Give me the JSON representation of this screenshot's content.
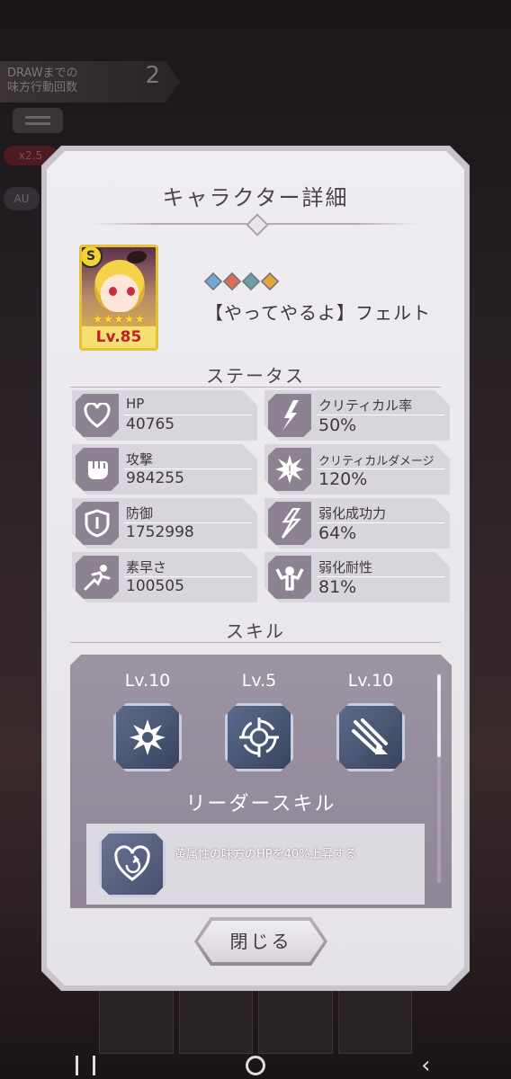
{
  "background": {
    "draw_label": "DRAWまでの\n味方行動回数",
    "draw_count": "2",
    "speed_label": "x2.5",
    "auto_label": "AU"
  },
  "dialog": {
    "title": "キャラクター詳細",
    "character": {
      "level_label": "Lv.85",
      "stars": "★★★★★",
      "attribute_symbol": "S",
      "name": "【やってやるよ】フェルト",
      "gem_colors": [
        "#6fa8d6",
        "#d9705e",
        "#6aa0a8",
        "#e3a43a"
      ]
    },
    "status_heading": "ステータス",
    "stats": [
      {
        "label": "HP",
        "value": "40765",
        "icon": "heart-icon"
      },
      {
        "label": "クリティカル率",
        "value": "50%",
        "icon": "critical-bolt-icon"
      },
      {
        "label": "攻撃",
        "value": "984255",
        "icon": "fist-icon"
      },
      {
        "label": "クリティカルダメージ",
        "value": "120%",
        "icon": "burst-icon"
      },
      {
        "label": "防御",
        "value": "1752998",
        "icon": "shield-icon"
      },
      {
        "label": "弱化成功力",
        "value": "64%",
        "icon": "debuff-icon"
      },
      {
        "label": "素早さ",
        "value": "100505",
        "icon": "runner-icon"
      },
      {
        "label": "弱化耐性",
        "value": "81%",
        "icon": "muscle-icon"
      }
    ],
    "skill_heading": "スキル",
    "skills": [
      {
        "level": "Lv.10",
        "icon": "impact-skill-icon"
      },
      {
        "level": "Lv.5",
        "icon": "target-skill-icon"
      },
      {
        "level": "Lv.10",
        "icon": "slash-skill-icon"
      }
    ],
    "leader_heading": "リーダースキル",
    "leader_text": "黄属性の味方のHPを40%上昇する",
    "close_label": "閉じる"
  },
  "colors": {
    "panel": "#efedf1",
    "stat_icon_bg": "#8c8291",
    "skill_panel": "#9d94a2",
    "level_text": "#c02030"
  }
}
